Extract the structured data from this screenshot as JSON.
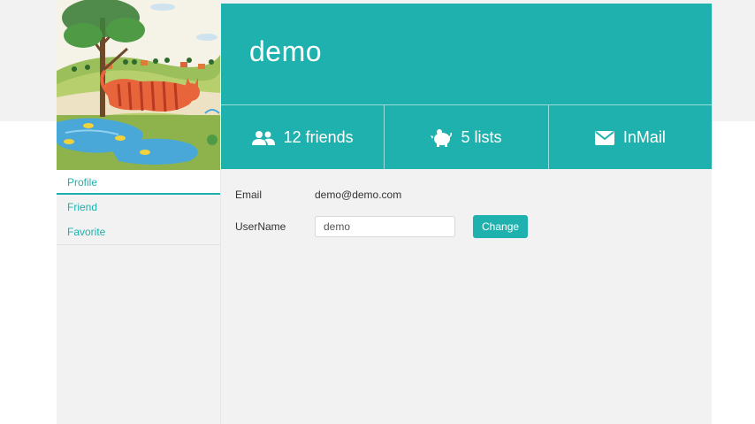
{
  "user": {
    "name": "demo"
  },
  "stats": [
    {
      "icon": "friends-icon",
      "label": "12 friends"
    },
    {
      "icon": "piggy-bank-icon",
      "label": "5 lists"
    },
    {
      "icon": "mail-icon",
      "label": "InMail"
    }
  ],
  "nav": {
    "items": [
      {
        "label": "Profile",
        "active": true
      },
      {
        "label": "Friend",
        "active": false
      },
      {
        "label": "Favorite",
        "active": false
      }
    ]
  },
  "profile": {
    "email_label": "Email",
    "email_value": "demo@demo.com",
    "username_label": "UserName",
    "username_value": "demo",
    "change_label": "Change"
  },
  "colors": {
    "accent": "#1fb1ae",
    "background": "#f2f2f2"
  }
}
